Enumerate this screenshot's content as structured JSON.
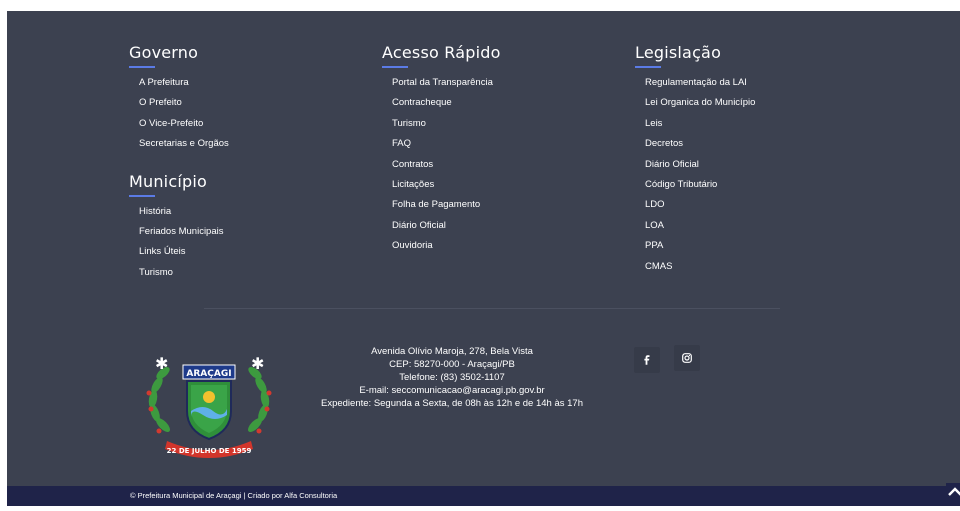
{
  "governo": {
    "title": "Governo",
    "items": [
      {
        "label": "A Prefeitura"
      },
      {
        "label": "O Prefeito"
      },
      {
        "label": "O Vice-Prefeito"
      },
      {
        "label": "Secretarias e Orgãos"
      }
    ]
  },
  "municipio": {
    "title": "Município",
    "items": [
      {
        "label": "História"
      },
      {
        "label": "Feriados Municipais"
      },
      {
        "label": "Links Úteis"
      },
      {
        "label": "Turismo"
      }
    ]
  },
  "acesso": {
    "title": "Acesso Rápido",
    "items": [
      {
        "label": "Portal da Transparência"
      },
      {
        "label": "Contracheque"
      },
      {
        "label": "Turismo"
      },
      {
        "label": "FAQ"
      },
      {
        "label": "Contratos"
      },
      {
        "label": "Licitações"
      },
      {
        "label": "Folha de Pagamento"
      },
      {
        "label": "Diário Oficial"
      },
      {
        "label": "Ouvidoria"
      }
    ]
  },
  "legislacao": {
    "title": "Legislação",
    "items": [
      {
        "label": "Regulamentação da LAI"
      },
      {
        "label": "Lei Organica do Município"
      },
      {
        "label": "Leis"
      },
      {
        "label": "Decretos"
      },
      {
        "label": "Diário Oficial"
      },
      {
        "label": "Código Tributário"
      },
      {
        "label": "LDO"
      },
      {
        "label": "LOA"
      },
      {
        "label": "PPA"
      },
      {
        "label": "CMAS"
      }
    ]
  },
  "logo": {
    "name": "ARAÇAGI",
    "date": "22 DE JULHO DE 1959"
  },
  "address": {
    "line1": "Avenida Olívio Maroja, 278, Bela Vista",
    "line2": "CEP: 58270-000 - Araçagi/PB",
    "line3": "Telefone: (83) 3502-1107",
    "line4": "E-mail: seccomunicacao@aracagi.pb.gov.br",
    "line5": "Expediente: Segunda a Sexta, de 08h às 12h e de 14h às 17h"
  },
  "social": {
    "facebook_icon": "facebook-icon",
    "instagram_icon": "instagram-icon"
  },
  "footer_bottom": {
    "copyright": "© Prefeitura Municipal de Araçagi | Criado por Alfa Consultoria"
  },
  "colors": {
    "background": "#3c4150",
    "accent": "#5b7be6",
    "bottom_bar": "#1f2349"
  }
}
